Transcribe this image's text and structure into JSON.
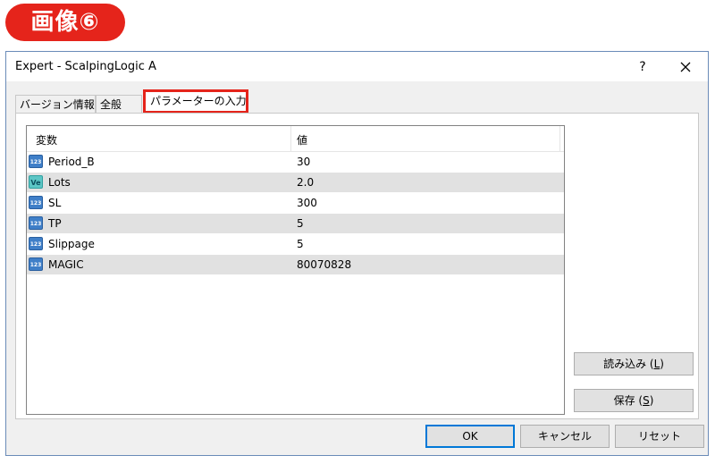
{
  "badge": {
    "label": "画像⑥"
  },
  "window": {
    "title": "Expert - ScalpingLogic A",
    "help_label": "?",
    "close_icon": "close-icon"
  },
  "tabs": [
    {
      "label": "バージョン情報"
    },
    {
      "label": "全般"
    },
    {
      "label": "パラメーターの入力",
      "selected": true
    }
  ],
  "table": {
    "col_variable": "変数",
    "col_value": "値",
    "rows": [
      {
        "icon": "123",
        "type": "int",
        "name": "Period_B",
        "value": "30"
      },
      {
        "icon": "Ve",
        "type": "double",
        "name": "Lots",
        "value": "2.0"
      },
      {
        "icon": "123",
        "type": "int",
        "name": "SL",
        "value": "300"
      },
      {
        "icon": "123",
        "type": "int",
        "name": "TP",
        "value": "5"
      },
      {
        "icon": "123",
        "type": "int",
        "name": "Slippage",
        "value": "5"
      },
      {
        "icon": "123",
        "type": "int",
        "name": "MAGIC",
        "value": "80070828"
      }
    ]
  },
  "buttons": {
    "load_prefix": "読み込み (",
    "load_key": "L",
    "load_suffix": ")",
    "save_prefix": "保存 (",
    "save_key": "S",
    "save_suffix": ")",
    "ok": "OK",
    "cancel": "キャンセル",
    "reset": "リセット"
  },
  "colors": {
    "accent_red": "#e5241b",
    "ok_border": "#0078d7",
    "row_alt": "#e1e1e1"
  }
}
